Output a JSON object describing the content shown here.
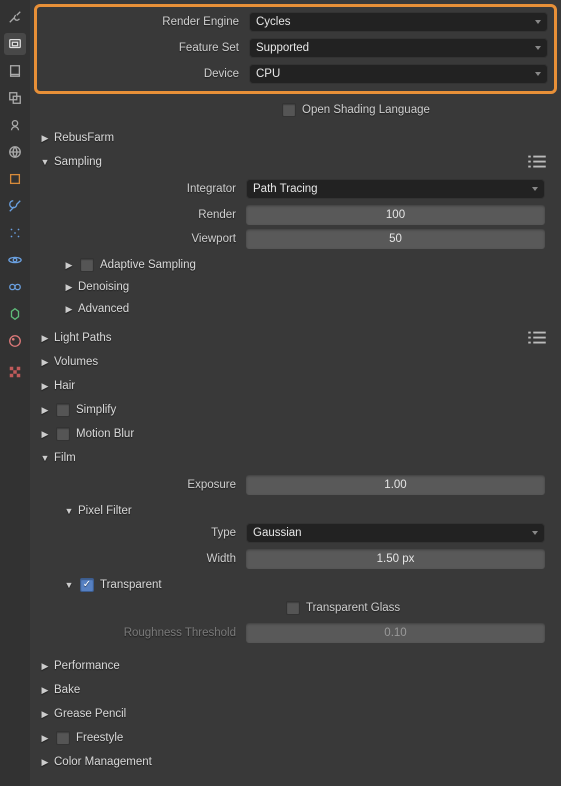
{
  "highlight": {
    "render_engine_label": "Render Engine",
    "render_engine_value": "Cycles",
    "feature_set_label": "Feature Set",
    "feature_set_value": "Supported",
    "device_label": "Device",
    "device_value": "CPU",
    "osl_label": "Open Shading Language"
  },
  "panels": {
    "rebusfarm": "RebusFarm",
    "sampling": "Sampling",
    "light_paths": "Light Paths",
    "volumes": "Volumes",
    "hair": "Hair",
    "simplify": "Simplify",
    "motion_blur": "Motion Blur",
    "film": "Film",
    "performance": "Performance",
    "bake": "Bake",
    "grease_pencil": "Grease Pencil",
    "freestyle": "Freestyle",
    "color_management": "Color Management"
  },
  "sampling": {
    "integrator_label": "Integrator",
    "integrator_value": "Path Tracing",
    "render_label": "Render",
    "render_value": "100",
    "viewport_label": "Viewport",
    "viewport_value": "50",
    "adaptive": "Adaptive Sampling",
    "denoising": "Denoising",
    "advanced": "Advanced"
  },
  "film": {
    "exposure_label": "Exposure",
    "exposure_value": "1.00",
    "pixel_filter": "Pixel Filter",
    "type_label": "Type",
    "type_value": "Gaussian",
    "width_label": "Width",
    "width_value": "1.50 px",
    "transparent": "Transparent",
    "transparent_glass": "Transparent Glass",
    "roughness_label": "Roughness Threshold",
    "roughness_value": "0.10"
  }
}
